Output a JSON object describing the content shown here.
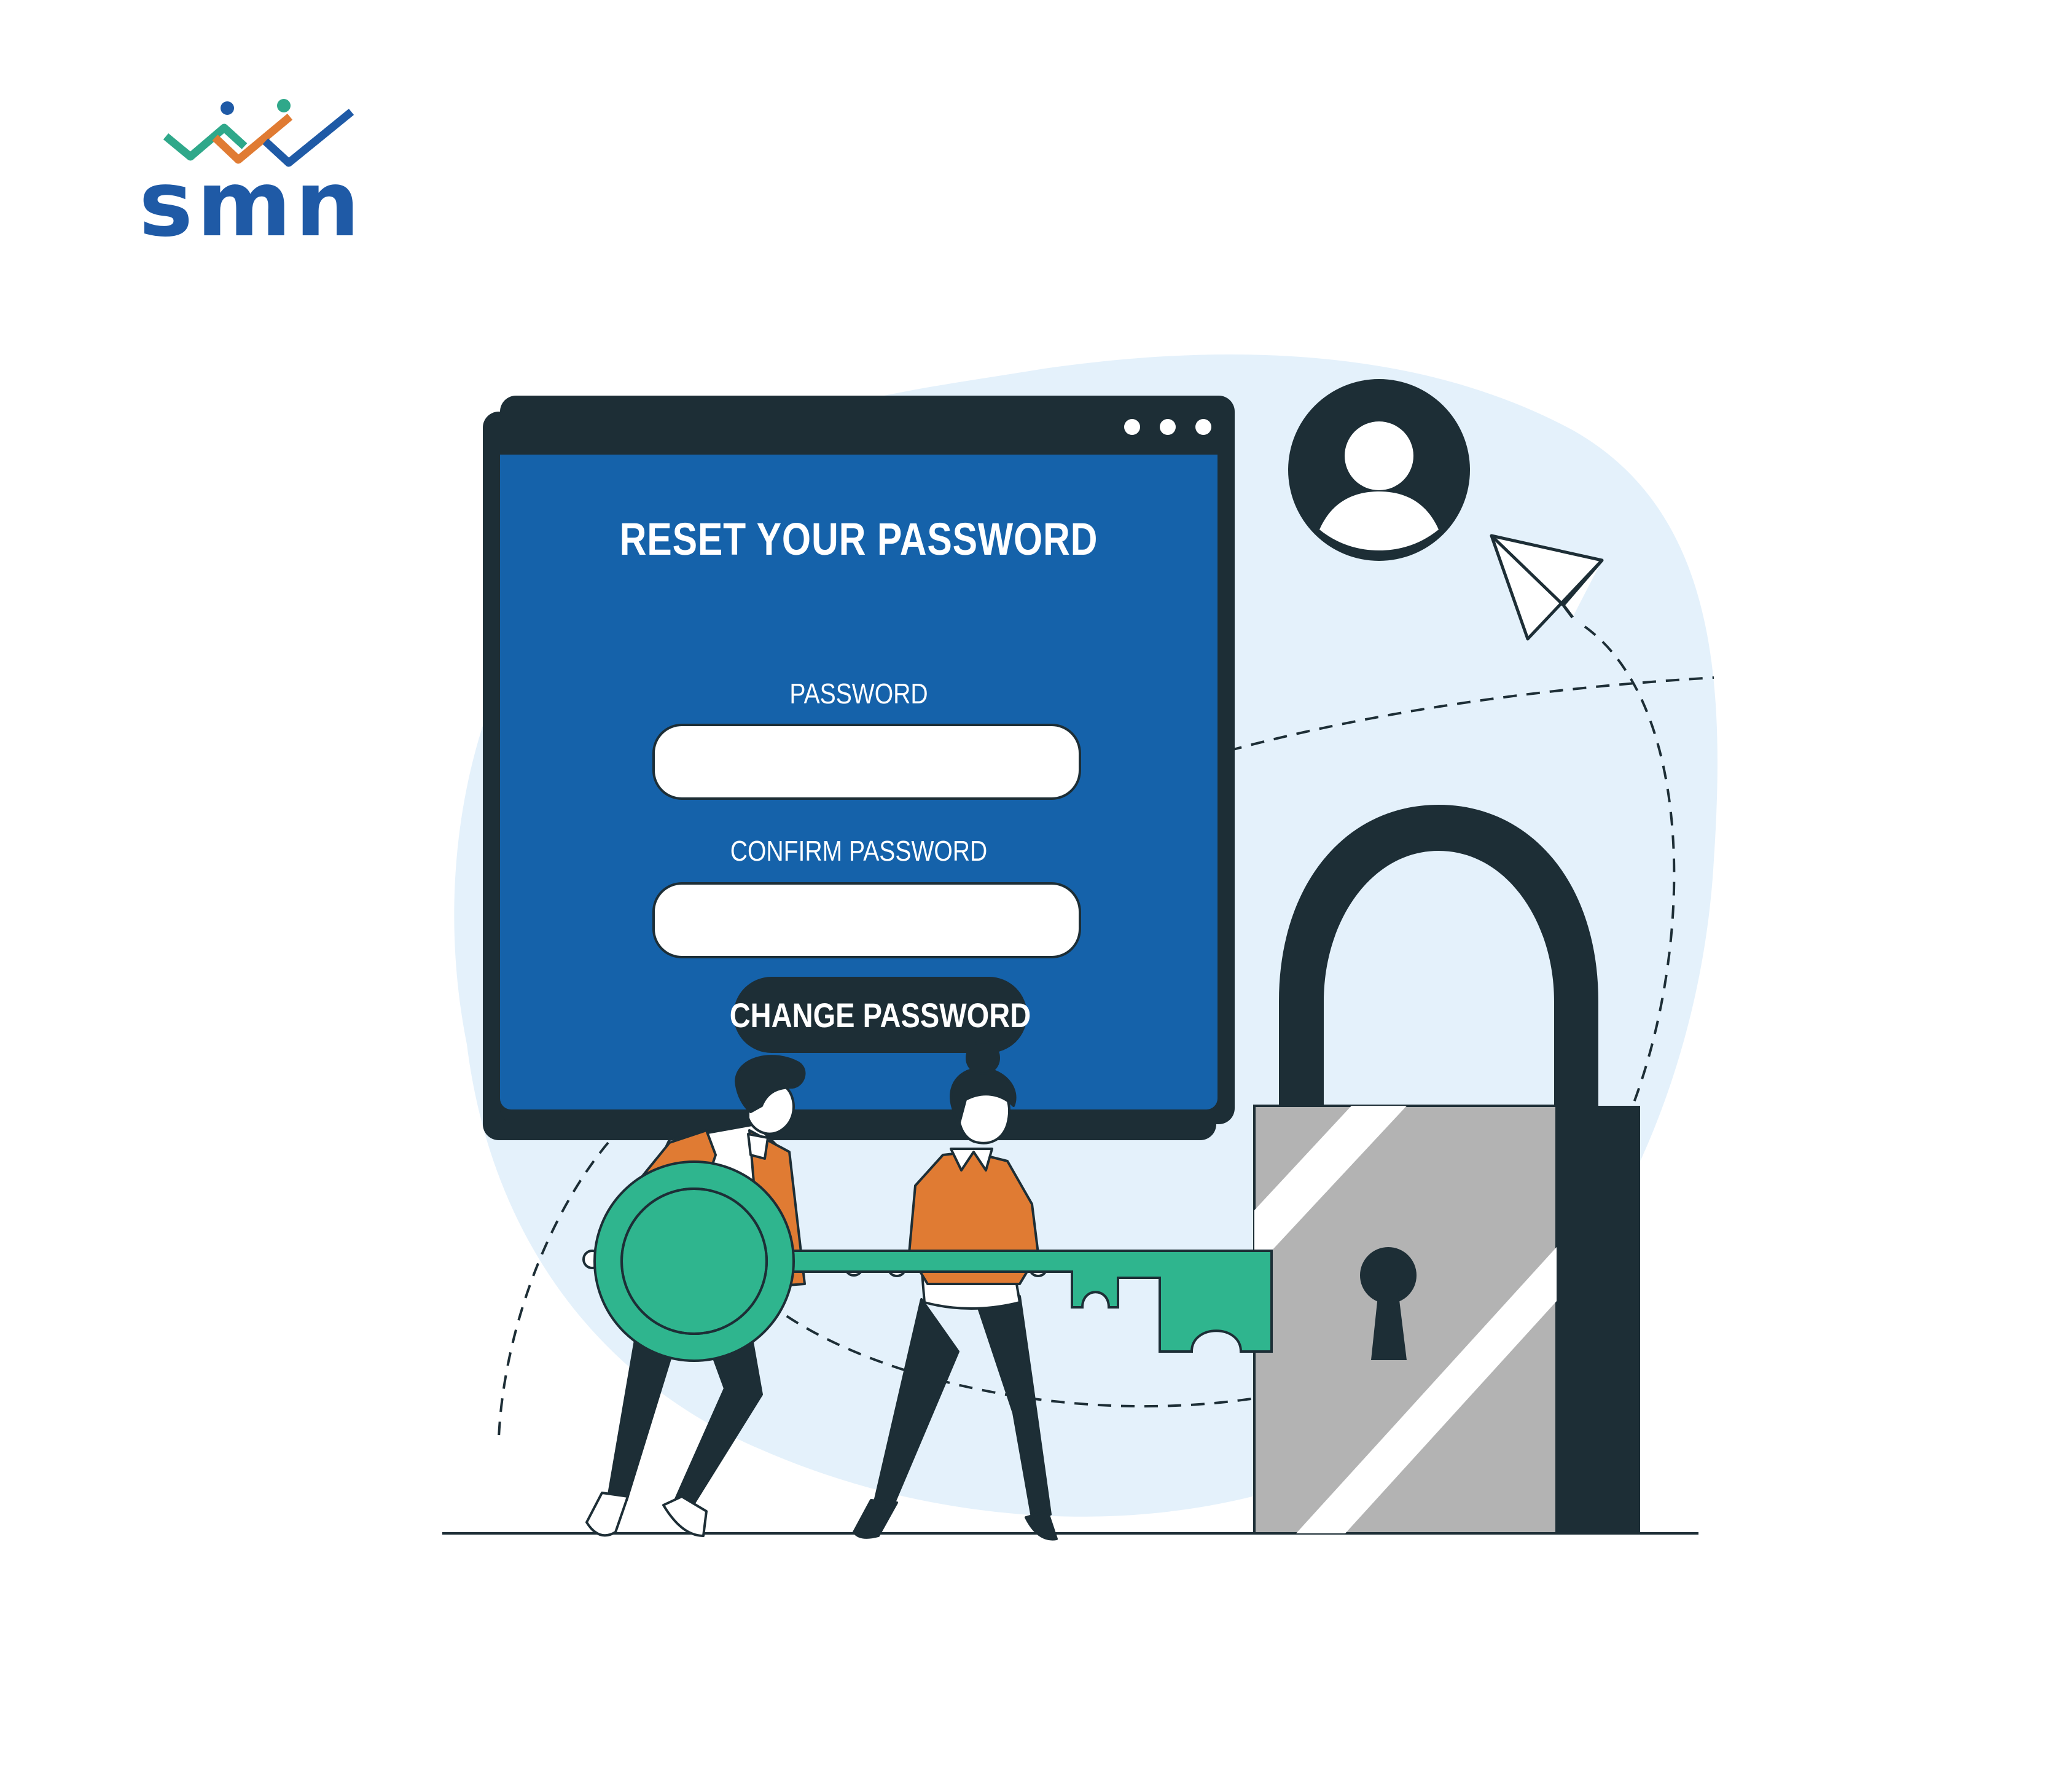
{
  "logo": {
    "text": "smn"
  },
  "reset_form": {
    "title": "RESET YOUR PASSWORD",
    "password_label": "PASSWORD",
    "confirm_label": "CONFIRM PASSWORD",
    "password_value": "",
    "confirm_value": "",
    "submit_label": "CHANGE PASSWORD"
  },
  "icons": [
    "logo-icon",
    "window-dots-icon",
    "user-avatar-icon",
    "paper-plane-icon",
    "padlock-icon",
    "keyhole-icon",
    "key-icon"
  ],
  "colors": {
    "brand_blue": "#1562aa",
    "dark": "#1d2e36",
    "key_green": "#2fb58e",
    "orange": "#e07b33",
    "bg_circle": "#e4f1fb",
    "lock_grey": "#b3b3b3"
  }
}
